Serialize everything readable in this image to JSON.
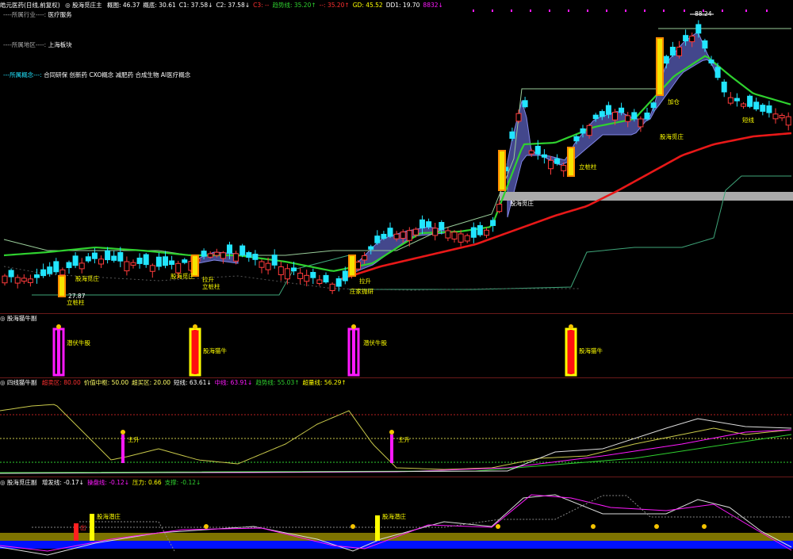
{
  "colors": {
    "up": "#ff3b3b",
    "down": "#22e5ff",
    "ma_red": "#e81818",
    "ma_green": "#2fd12f",
    "band_fill": "#4b4f9c",
    "yellow": "#f5e400",
    "magenta": "#ff19ff",
    "grey_bar": "#aaaaaa",
    "gold": "#7d7300",
    "blue": "#0011ff"
  },
  "main_panel": {
    "header": {
      "stock": "皓元医药(日线,前复权)",
      "indicator": "◎ 股海觅庄主",
      "items": [
        {
          "label": "概图: 46.37",
          "color": "#ffffff"
        },
        {
          "label": "概底: 30.61",
          "color": "#ffffff"
        },
        {
          "label": "C1: 37.58↓",
          "color": "#ffffff"
        },
        {
          "label": "C2: 37.58↓",
          "color": "#ffffff"
        },
        {
          "label": "C3: --",
          "color": "#ff3030"
        },
        {
          "label": "趋势线: 35.20↑",
          "color": "#2fd12f"
        },
        {
          "label": "--: 35.20↑",
          "color": "#ff3030"
        },
        {
          "label": "GD: 45.52",
          "color": "#ffff00"
        },
        {
          "label": "DD1: 19.70",
          "color": "#ffffff"
        },
        {
          "label": "8832↓",
          "color": "#ff19ff"
        }
      ]
    },
    "info_lines": [
      {
        "label": "----所属行业----:",
        "value": "医疗服务"
      },
      {
        "label": "----所属地区----:",
        "value": "上海板块"
      },
      {
        "label": "---所属概念---:",
        "value": "合同研保 创新药 CXO概念 减肥药 合成生物 AI医疗概念"
      }
    ],
    "price_labels": {
      "high": "88.24",
      "low": "27.87"
    },
    "annotations": [
      {
        "text": "股海觅庄",
        "color": "#ffff00"
      },
      {
        "text": "立桩柱",
        "color": "#ffff00"
      },
      {
        "text": "拉升",
        "color": "#ffff00"
      },
      {
        "text": "立桩柱",
        "color": "#ffff00"
      },
      {
        "text": "拉升",
        "color": "#ffff00"
      },
      {
        "text": "庄家抛研",
        "color": "#ffff00"
      },
      {
        "text": "股海觅庄",
        "color": "#ffff00"
      },
      {
        "text": "股海觅庄",
        "color": "#ffffff"
      },
      {
        "text": "立桩柱",
        "color": "#ffff00"
      },
      {
        "text": "加仓",
        "color": "#ffff00"
      },
      {
        "text": "股海觅庄",
        "color": "#ffff00"
      },
      {
        "text": "短线",
        "color": "#ffff00"
      }
    ]
  },
  "panel2": {
    "title": "◎ 股海猫牛副",
    "labels": [
      "潜伏牛股",
      "股海猫牛",
      "潜伏牛股",
      "股海猫牛"
    ]
  },
  "panel3": {
    "title": "◎ 四线猫牛副",
    "items": [
      {
        "label": "超卖区: 80.00",
        "color": "#ff3030"
      },
      {
        "label": "价值中枢: 50.00",
        "color": "#ffff66"
      },
      {
        "label": "超买区: 20.00",
        "color": "#ffff66"
      },
      {
        "label": "短线: 63.61↓",
        "color": "#ffffff"
      },
      {
        "label": "中线: 63.91↓",
        "color": "#ff19ff"
      },
      {
        "label": "趋势线: 55.03↑",
        "color": "#2fd12f"
      },
      {
        "label": "超量线: 56.29↑",
        "color": "#ffff00"
      }
    ],
    "labels": [
      "主升",
      "主升"
    ]
  },
  "panel4": {
    "title": "◎ 股海觅庄副",
    "items": [
      {
        "label": "增发线: -0.17↓",
        "color": "#ffffff"
      },
      {
        "label": "操盘线: -0.12↓",
        "color": "#ff19ff"
      },
      {
        "label": "压力: 0.66",
        "color": "#ffff00"
      },
      {
        "label": "支撑: -0.12↓",
        "color": "#2fd12f"
      }
    ],
    "labels": [
      "出",
      "股海潜庄",
      "股海潜庄"
    ]
  }
}
